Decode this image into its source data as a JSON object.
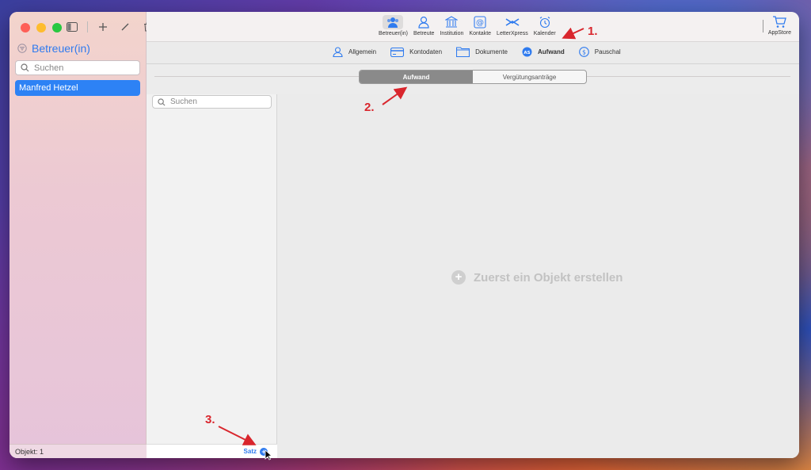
{
  "sidebar": {
    "title": "Betreuer(in)",
    "search_placeholder": "Suchen",
    "selected_item": "Manfred Hetzel",
    "footer": "Objekt: 1"
  },
  "toolbar": {
    "items": [
      {
        "label": "Betreuer(in)",
        "icon": "person-group-icon",
        "active": true
      },
      {
        "label": "Betreute",
        "icon": "person-icon"
      },
      {
        "label": "Institution",
        "icon": "bank-icon"
      },
      {
        "label": "Kontakte",
        "icon": "at-card-icon"
      },
      {
        "label": "LetterXpress",
        "icon": "letterxpress-icon"
      },
      {
        "label": "Kalender",
        "icon": "alarm-clock-icon"
      }
    ],
    "appstore": "AppStore"
  },
  "subtabs": [
    {
      "label": "Allgemein",
      "icon": "person-outline-icon"
    },
    {
      "label": "Kontodaten",
      "icon": "credit-card-icon"
    },
    {
      "label": "Dokumente",
      "icon": "folder-icon"
    },
    {
      "label": "Aufwand",
      "icon": "as-badge-icon",
      "active": true
    },
    {
      "label": "Pauschal",
      "icon": "dollar-circle-icon"
    }
  ],
  "segment": {
    "items": [
      "Aufwand",
      "Vergütungsanträge"
    ],
    "active": 0
  },
  "list": {
    "search_placeholder": "Suchen",
    "add_label": "Satz"
  },
  "detail": {
    "empty_text": "Zuerst ein Objekt erstellen"
  },
  "annotations": [
    "1.",
    "2.",
    "3."
  ],
  "colors": {
    "accent": "#2f7bef",
    "annotation": "#d9262d"
  }
}
